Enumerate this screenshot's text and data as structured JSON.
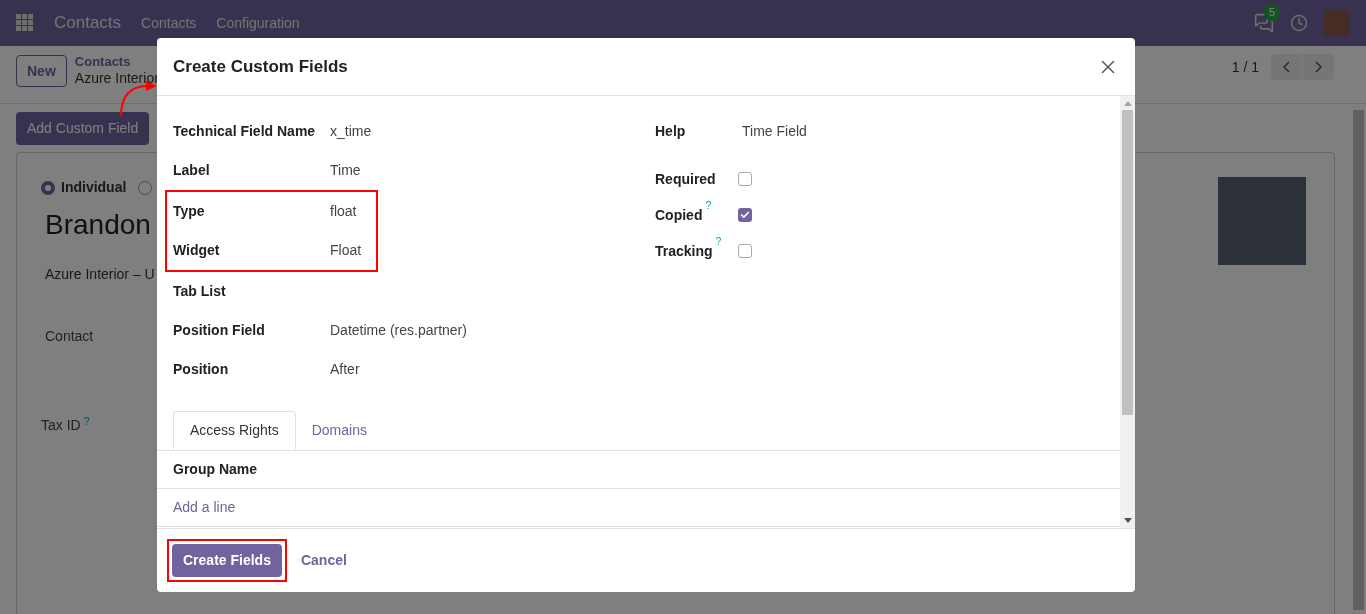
{
  "navbar": {
    "app_name": "Contacts",
    "menu": [
      "Contacts",
      "Configuration"
    ],
    "message_count": "5"
  },
  "control_panel": {
    "new_button": "New",
    "breadcrumb": [
      "Contacts",
      "Azure Interior"
    ],
    "pager": "1 / 1",
    "action_button": "Add Custom Field"
  },
  "form": {
    "company_types": [
      {
        "label": "Individual",
        "selected": true
      },
      {
        "selected": false
      }
    ],
    "name": "Brandon",
    "company": "Azure Interior – U",
    "fields": [
      {
        "label": "Contact"
      },
      {
        "label": "Tax ID",
        "help": "?"
      }
    ]
  },
  "dialog": {
    "title": "Create Custom Fields",
    "left_field_groups": [
      {
        "highlighted": false,
        "fields": [
          {
            "label": "Technical Field Name",
            "value": "x_time"
          },
          {
            "label": "Label",
            "value": "Time"
          }
        ]
      },
      {
        "highlighted": true,
        "fields": [
          {
            "label": "Type",
            "value": "float"
          },
          {
            "label": "Widget",
            "value": "Float"
          }
        ]
      },
      {
        "highlighted": false,
        "fields": [
          {
            "label": "Tab List"
          },
          {
            "label": "Position Field",
            "value": "Datetime (res.partner)"
          },
          {
            "label": "Position",
            "value": "After"
          }
        ]
      }
    ],
    "help": {
      "label": "Help",
      "value": "Time Field"
    },
    "options": [
      {
        "label": "Required",
        "checked": false
      },
      {
        "label": "Copied",
        "help": "?",
        "checked": true
      },
      {
        "label": "Tracking",
        "help": "?",
        "checked": false
      }
    ],
    "tabs": [
      {
        "label": "Access Rights",
        "selected": true
      },
      {
        "label": "Domains",
        "selected": false
      }
    ],
    "table": {
      "columns": [
        "Group Name"
      ],
      "add_line": "Add a line"
    },
    "primary_button": {
      "label": "Create Fields",
      "highlighted": true
    },
    "cancel_button": "Cancel"
  }
}
